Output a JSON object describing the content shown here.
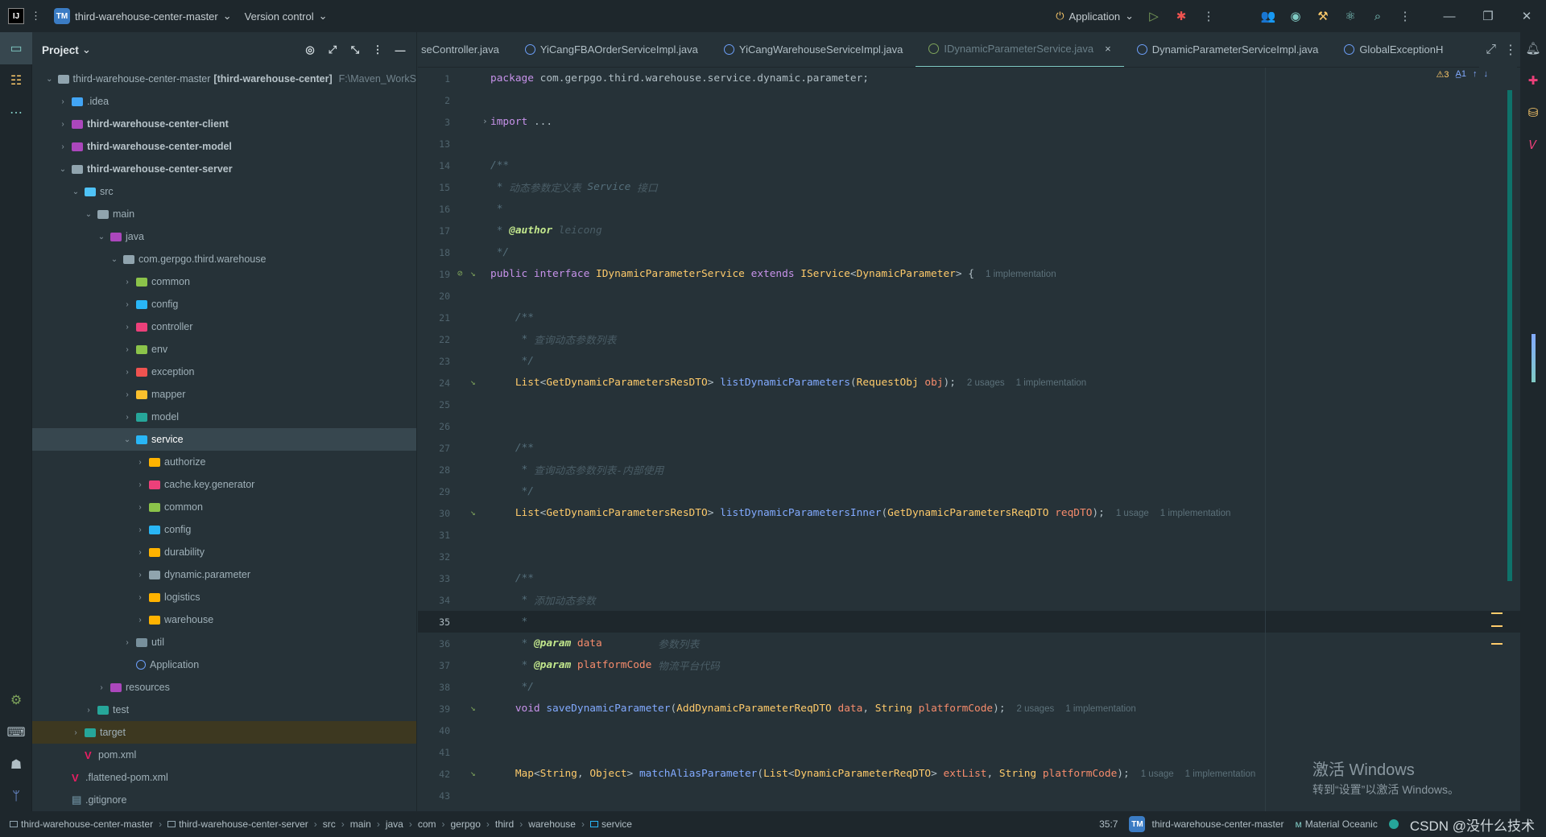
{
  "titlebar": {
    "logo": "IJ",
    "project_badge": "TM",
    "project": "third-warehouse-center-master",
    "vcs": "Version control",
    "run_config": "Application"
  },
  "project_panel": {
    "title": "Project",
    "tree": [
      {
        "label": "third-warehouse-center-master",
        "extra": "[third-warehouse-center]",
        "path": "F:\\Maven_WorkS",
        "depth": 0,
        "arrow": "v",
        "color": "#90a4ae",
        "bold": false
      },
      {
        "label": ".idea",
        "depth": 1,
        "arrow": ">",
        "color": "#42a5f5"
      },
      {
        "label": "third-warehouse-center-client",
        "depth": 1,
        "arrow": ">",
        "color": "#ab47bc",
        "bold": true
      },
      {
        "label": "third-warehouse-center-model",
        "depth": 1,
        "arrow": ">",
        "color": "#ab47bc",
        "bold": true
      },
      {
        "label": "third-warehouse-center-server",
        "depth": 1,
        "arrow": "v",
        "color": "#90a4ae",
        "bold": true
      },
      {
        "label": "src",
        "depth": 2,
        "arrow": "v",
        "color": "#4fc3f7"
      },
      {
        "label": "main",
        "depth": 3,
        "arrow": "v",
        "color": "#90a4ae"
      },
      {
        "label": "java",
        "depth": 4,
        "arrow": "v",
        "color": "#ab47bc"
      },
      {
        "label": "com.gerpgo.third.warehouse",
        "depth": 5,
        "arrow": "v",
        "color": "#90a4ae"
      },
      {
        "label": "common",
        "depth": 6,
        "arrow": ">",
        "color": "#8bc34a"
      },
      {
        "label": "config",
        "depth": 6,
        "arrow": ">",
        "color": "#29b6f6"
      },
      {
        "label": "controller",
        "depth": 6,
        "arrow": ">",
        "color": "#ec407a"
      },
      {
        "label": "env",
        "depth": 6,
        "arrow": ">",
        "color": "#8bc34a"
      },
      {
        "label": "exception",
        "depth": 6,
        "arrow": ">",
        "color": "#ef5350"
      },
      {
        "label": "mapper",
        "depth": 6,
        "arrow": ">",
        "color": "#fbc02d"
      },
      {
        "label": "model",
        "depth": 6,
        "arrow": ">",
        "color": "#26a69a"
      },
      {
        "label": "service",
        "depth": 6,
        "arrow": "v",
        "color": "#29b6f6",
        "selected": true
      },
      {
        "label": "authorize",
        "depth": 7,
        "arrow": ">",
        "color": "#ffb300"
      },
      {
        "label": "cache.key.generator",
        "depth": 7,
        "arrow": ">",
        "color": "#ec407a"
      },
      {
        "label": "common",
        "depth": 7,
        "arrow": ">",
        "color": "#8bc34a"
      },
      {
        "label": "config",
        "depth": 7,
        "arrow": ">",
        "color": "#29b6f6"
      },
      {
        "label": "durability",
        "depth": 7,
        "arrow": ">",
        "color": "#ffb300"
      },
      {
        "label": "dynamic.parameter",
        "depth": 7,
        "arrow": ">",
        "color": "#90a4ae"
      },
      {
        "label": "logistics",
        "depth": 7,
        "arrow": ">",
        "color": "#ffb300"
      },
      {
        "label": "warehouse",
        "depth": 7,
        "arrow": ">",
        "color": "#ffb300"
      },
      {
        "label": "util",
        "depth": 6,
        "arrow": ">",
        "color": "#78909c"
      },
      {
        "label": "Application",
        "depth": 6,
        "arrow": "",
        "color": "#6c9ef8",
        "round": true
      },
      {
        "label": "resources",
        "depth": 4,
        "arrow": ">",
        "color": "#ab47bc"
      },
      {
        "label": "test",
        "depth": 3,
        "arrow": ">",
        "color": "#26a69a"
      },
      {
        "label": "target",
        "depth": 2,
        "arrow": ">",
        "color": "#26a69a",
        "highlight": true
      },
      {
        "label": "pom.xml",
        "depth": 2,
        "arrow": "",
        "color": "#e91e63",
        "file": true
      },
      {
        "label": ".flattened-pom.xml",
        "depth": 1,
        "arrow": "",
        "color": "#e91e63",
        "file": true
      },
      {
        "label": ".gitignore",
        "depth": 1,
        "arrow": "",
        "color": "#607d8b",
        "file": true
      }
    ]
  },
  "tabs": [
    {
      "label": "seController.java",
      "kind": "none"
    },
    {
      "label": "YiCangFBAOrderServiceImpl.java",
      "kind": "class"
    },
    {
      "label": "YiCangWarehouseServiceImpl.java",
      "kind": "class"
    },
    {
      "label": "IDynamicParameterService.java",
      "kind": "interface",
      "active": true
    },
    {
      "label": "DynamicParameterServiceImpl.java",
      "kind": "class"
    },
    {
      "label": "GlobalExceptionH",
      "kind": "class"
    }
  ],
  "inspections": {
    "warnings": "3",
    "typos": "1"
  },
  "code": [
    {
      "n": "1",
      "t": [
        [
          "kw",
          "package "
        ],
        [
          "txt",
          "com.gerpgo.third.warehouse.service.dynamic.parameter;"
        ]
      ]
    },
    {
      "n": "2",
      "t": []
    },
    {
      "n": "3",
      "t": [
        [
          "kw",
          "import "
        ],
        [
          "txt",
          "..."
        ]
      ],
      "fold": true
    },
    {
      "n": "13",
      "t": []
    },
    {
      "n": "14",
      "t": [
        [
          "cm",
          "/**"
        ]
      ]
    },
    {
      "n": "15",
      "t": [
        [
          "cm",
          " * "
        ],
        [
          "cmt",
          "动态参数定义表 "
        ],
        [
          "cm",
          "Service "
        ],
        [
          "cmt",
          "接口"
        ]
      ]
    },
    {
      "n": "16",
      "t": [
        [
          "cm",
          " *"
        ]
      ]
    },
    {
      "n": "17",
      "t": [
        [
          "cm",
          " * "
        ],
        [
          "tag",
          "@author "
        ],
        [
          "cmt",
          "leicong"
        ]
      ]
    },
    {
      "n": "18",
      "t": [
        [
          "cm",
          " */"
        ]
      ]
    },
    {
      "n": "19",
      "t": [
        [
          "kw",
          "public interface "
        ],
        [
          "ty",
          "IDynamicParameterService "
        ],
        [
          "kw",
          "extends "
        ],
        [
          "ty",
          "IService"
        ],
        [
          "txt",
          "<"
        ],
        [
          "ty",
          "DynamicParameter"
        ],
        [
          "txt",
          "> {"
        ]
      ],
      "hints": [
        "1 implementation"
      ],
      "g": "ri"
    },
    {
      "n": "20",
      "t": []
    },
    {
      "n": "21",
      "t": [
        [
          "cm",
          "    /**"
        ]
      ]
    },
    {
      "n": "22",
      "t": [
        [
          "cm",
          "     * "
        ],
        [
          "cmt",
          "查询动态参数列表"
        ]
      ]
    },
    {
      "n": "23",
      "t": [
        [
          "cm",
          "     */"
        ]
      ]
    },
    {
      "n": "24",
      "t": [
        [
          "ty",
          "    List"
        ],
        [
          "txt",
          "<"
        ],
        [
          "ty",
          "GetDynamicParametersResDTO"
        ],
        [
          "txt",
          "> "
        ],
        [
          "fn",
          "listDynamicParameters"
        ],
        [
          "txt",
          "("
        ],
        [
          "ty",
          "RequestObj "
        ],
        [
          "pr",
          "obj"
        ],
        [
          "txt",
          ");"
        ]
      ],
      "hints": [
        "2 usages",
        "1 implementation"
      ],
      "g": "i"
    },
    {
      "n": "25",
      "t": []
    },
    {
      "n": "26",
      "t": []
    },
    {
      "n": "27",
      "t": [
        [
          "cm",
          "    /**"
        ]
      ]
    },
    {
      "n": "28",
      "t": [
        [
          "cm",
          "     * "
        ],
        [
          "cmt",
          "查询动态参数列表-内部使用"
        ]
      ]
    },
    {
      "n": "29",
      "t": [
        [
          "cm",
          "     */"
        ]
      ]
    },
    {
      "n": "30",
      "t": [
        [
          "ty",
          "    List"
        ],
        [
          "txt",
          "<"
        ],
        [
          "ty",
          "GetDynamicParametersResDTO"
        ],
        [
          "txt",
          "> "
        ],
        [
          "fn",
          "listDynamicParametersInner"
        ],
        [
          "txt",
          "("
        ],
        [
          "ty",
          "GetDynamicParametersReqDTO "
        ],
        [
          "pr",
          "reqDTO"
        ],
        [
          "txt",
          ");"
        ]
      ],
      "hints": [
        "1 usage",
        "1 implementation"
      ],
      "g": "i"
    },
    {
      "n": "31",
      "t": []
    },
    {
      "n": "32",
      "t": []
    },
    {
      "n": "33",
      "t": [
        [
          "cm",
          "    /**"
        ]
      ]
    },
    {
      "n": "34",
      "t": [
        [
          "cm",
          "     * "
        ],
        [
          "cmt",
          "添加动态参数"
        ]
      ]
    },
    {
      "n": "35",
      "t": [
        [
          "cm",
          "     *"
        ]
      ],
      "cur": true
    },
    {
      "n": "36",
      "t": [
        [
          "cm",
          "     * "
        ],
        [
          "tag",
          "@param "
        ],
        [
          "pr",
          "data         "
        ],
        [
          "cmt",
          "参数列表"
        ]
      ]
    },
    {
      "n": "37",
      "t": [
        [
          "cm",
          "     * "
        ],
        [
          "tag",
          "@param "
        ],
        [
          "pr",
          "platformCode "
        ],
        [
          "cmt",
          "物流平台代码"
        ]
      ]
    },
    {
      "n": "38",
      "t": [
        [
          "cm",
          "     */"
        ]
      ]
    },
    {
      "n": "39",
      "t": [
        [
          "kw",
          "    void "
        ],
        [
          "fn",
          "saveDynamicParameter"
        ],
        [
          "txt",
          "("
        ],
        [
          "ty",
          "AddDynamicParameterReqDTO "
        ],
        [
          "pr",
          "data"
        ],
        [
          "txt",
          ", "
        ],
        [
          "ty",
          "String "
        ],
        [
          "pr",
          "platformCode"
        ],
        [
          "txt",
          ");"
        ]
      ],
      "hints": [
        "2 usages",
        "1 implementation"
      ],
      "g": "i"
    },
    {
      "n": "40",
      "t": []
    },
    {
      "n": "41",
      "t": []
    },
    {
      "n": "42",
      "t": [
        [
          "ty",
          "    Map"
        ],
        [
          "txt",
          "<"
        ],
        [
          "ty",
          "String"
        ],
        [
          "txt",
          ", "
        ],
        [
          "ty",
          "Object"
        ],
        [
          "txt",
          "> "
        ],
        [
          "fn",
          "matchAliasParameter"
        ],
        [
          "txt",
          "("
        ],
        [
          "ty",
          "List"
        ],
        [
          "txt",
          "<"
        ],
        [
          "ty",
          "DynamicParameterReqDTO"
        ],
        [
          "txt",
          "> "
        ],
        [
          "pr",
          "extList"
        ],
        [
          "txt",
          ", "
        ],
        [
          "ty",
          "String "
        ],
        [
          "pr",
          "platformCode"
        ],
        [
          "txt",
          ");"
        ]
      ],
      "hints": [
        "1 usage",
        "1 implementation"
      ],
      "g": "i"
    },
    {
      "n": "43",
      "t": []
    }
  ],
  "statusbar": {
    "breadcrumbs": [
      "third-warehouse-center-master",
      "third-warehouse-center-server",
      "src",
      "main",
      "java",
      "com",
      "gerpgo",
      "third",
      "warehouse",
      "service"
    ],
    "position": "35:7",
    "project_badge": "TM",
    "project": "third-warehouse-center-master",
    "theme": "Material Oceanic",
    "csdn": "CSDN @没什么技术"
  },
  "watermark": {
    "line1": "激活 Windows",
    "line2": "转到“设置”以激活 Windows。"
  },
  "colors": {
    "accent": "#80cbc4",
    "bg": "#263238",
    "chrome": "#1e272c"
  },
  "icons": [
    "menu-icon",
    "run-icon",
    "debug-icon",
    "more-icon",
    "collab-icon",
    "record-icon",
    "build-icon",
    "ai-assistant-icon",
    "search-icon",
    "settings-icon",
    "minimize-icon",
    "maximize-icon",
    "close-icon"
  ]
}
